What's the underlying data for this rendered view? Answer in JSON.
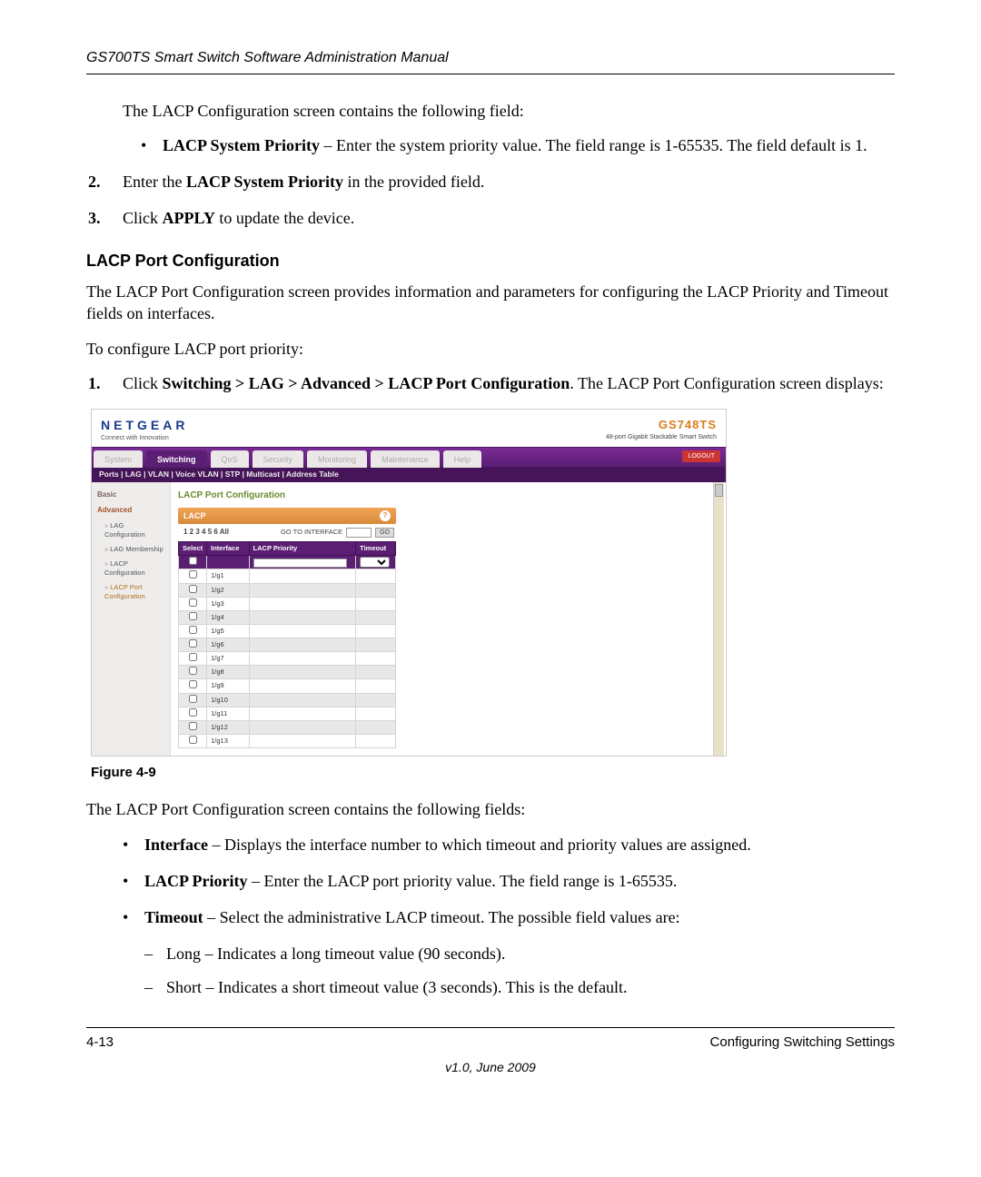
{
  "header": "GS700TS Smart Switch Software Administration Manual",
  "para_intro": "The LACP Configuration screen contains the following field:",
  "bullet_sys_priority_label": "LACP System Priority",
  "bullet_sys_priority_text": " – Enter the system priority value. The field range is 1-65535. The field default is 1.",
  "step2_pre": "Enter the ",
  "step2_bold": "LACP System Priority",
  "step2_post": " in the provided field.",
  "step3_pre": "Click ",
  "step3_bold": "APPLY",
  "step3_post": " to update the device.",
  "section_title": "LACP Port Configuration",
  "para_portcfg": "The LACP Port Configuration screen provides information and parameters for configuring the LACP Priority and Timeout fields on interfaces.",
  "para_toconf": "To configure LACP port priority:",
  "step1b_pre": "Click ",
  "step1b_bold": "Switching > LAG > Advanced > LACP Port Configuration",
  "step1b_post": ". The LACP Port Configuration screen displays:",
  "figure_caption": "Figure 4-9",
  "para_contains": "The LACP Port Configuration screen contains the following fields:",
  "field_interface_label": "Interface",
  "field_interface_text": " – Displays the interface number to which timeout and priority values are assigned.",
  "field_lacpprio_label": "LACP Priority",
  "field_lacpprio_text": " – Enter the LACP port priority value. The field range is 1-65535.",
  "field_timeout_label": "Timeout",
  "field_timeout_text": " – Select the administrative LACP timeout. The possible field values are:",
  "timeout_long": "Long – Indicates a long timeout value (90 seconds).",
  "timeout_short": "Short – Indicates a short timeout value (3 seconds). This is the default.",
  "footer_page": "4-13",
  "footer_section": "Configuring Switching Settings",
  "footer_version": "v1.0, June 2009",
  "ui": {
    "brand": "NETGEAR",
    "brand_tag": "Connect with Innovation",
    "model": "GS748TS",
    "model_desc": "48-port Gigabit Stackable Smart Switch",
    "tabs": [
      "System",
      "Switching",
      "QoS",
      "Security",
      "Monitoring",
      "Maintenance",
      "Help"
    ],
    "active_tab": "Switching",
    "logout": "LOGOUT",
    "subnav": "Ports | LAG | VLAN | Voice VLAN | STP | Multicast | Address Table",
    "side_basic": "Basic",
    "side_advanced": "Advanced",
    "side_items": [
      "LAG Configuration",
      "LAG Membership",
      "LACP Configuration",
      "LACP Port Configuration"
    ],
    "content_title": "LACP Port Configuration",
    "lacp_label": "LACP",
    "pager_nums": "1 2 3 4 5 6 All",
    "goto_label": "GO TO INTERFACE",
    "go_btn": "GO",
    "th_select": "Select",
    "th_interface": "Interface",
    "th_lacp": "LACP Priority",
    "th_timeout": "Timeout",
    "rows": [
      "1/g1",
      "1/g2",
      "1/g3",
      "1/g4",
      "1/g5",
      "1/g6",
      "1/g7",
      "1/g8",
      "1/g9",
      "1/g10",
      "1/g11",
      "1/g12",
      "1/g13"
    ]
  }
}
